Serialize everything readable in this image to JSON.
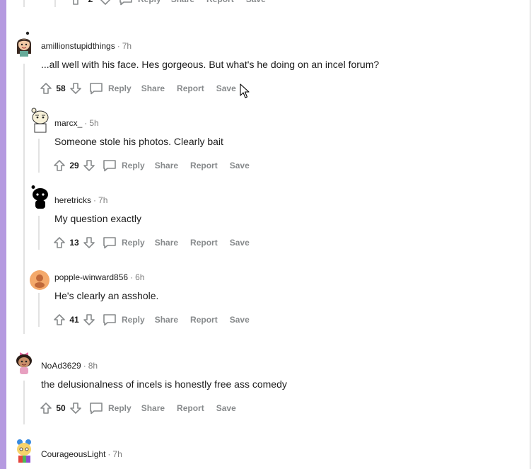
{
  "labels": {
    "reply": "Reply",
    "share": "Share",
    "report": "Report",
    "save": "Save"
  },
  "top_partial": {
    "score": "2"
  },
  "comments": [
    {
      "author": "amillionstupidthings",
      "sep": "·",
      "time": "7h",
      "text": "...all well with his face. Hes gorgeous. But what's he doing on an incel forum?",
      "score": "58",
      "avatar": "avatar-girl-icon"
    },
    {
      "author": "marcx_",
      "sep": "·",
      "time": "5h",
      "text": "Someone stole his photos. Clearly bait",
      "score": "29",
      "avatar": "avatar-robot-icon"
    },
    {
      "author": "heretricks",
      "sep": "·",
      "time": "7h",
      "text": "My question exactly",
      "score": "13",
      "avatar": "avatar-silhouette-icon"
    },
    {
      "author": "popple-winward856",
      "sep": "·",
      "time": "6h",
      "text": "He's clearly an asshole.",
      "score": "41",
      "avatar": "avatar-default-icon"
    },
    {
      "author": "NoAd3629",
      "sep": "·",
      "time": "8h",
      "text": "the delusionalness of incels is honestly free ass comedy",
      "score": "50",
      "avatar": "avatar-bow-icon"
    },
    {
      "author": "CourageousLight",
      "sep": "·",
      "time": "7h",
      "avatar": "avatar-colorful-icon"
    }
  ],
  "colors": {
    "accent_bar": "#b59ae0",
    "meta": "#7c7c7c",
    "action": "#878a8c",
    "thread": "#e2e2e2"
  }
}
